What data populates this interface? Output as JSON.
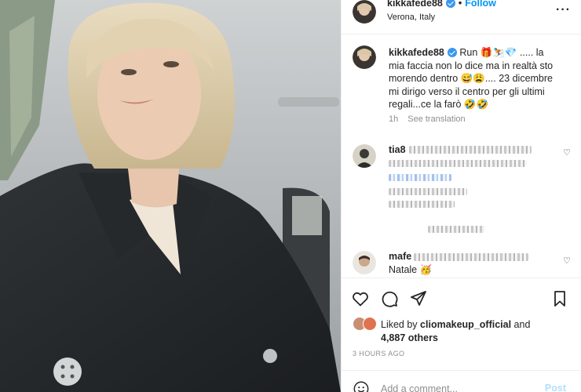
{
  "post": {
    "username": "kikkafede88",
    "separator": "•",
    "follow_label": "Follow",
    "location": "Verona, Italy",
    "more_icon": "more-horizontal-icon",
    "more_label": "···"
  },
  "caption": {
    "username": "kikkafede88",
    "text": "Run 🎁⛷️💎 ..... la mia faccia non lo dice ma in realtà sto morendo dentro 😅😩.... 23 dicembre mi dirigo verso il centro per gli ultimi regali...ce la farò 🤣🤣",
    "time": "1h",
    "translate_label": "See translation"
  },
  "comments": [
    {
      "username": "tia8",
      "heart_icon": "heart-outline-icon",
      "heart_label": "♡"
    },
    {
      "username": "mafe",
      "text": "Natale 🥳",
      "heart_icon": "heart-outline-icon",
      "heart_label": "♡"
    }
  ],
  "likes": {
    "prefix": "Liked by",
    "liker": "cliomakeup_official",
    "and_label": "and",
    "others": "4,887 others"
  },
  "time_ago": "3 HOURS AGO",
  "add_comment": {
    "placeholder": "Add a comment...",
    "post_label": "Post"
  },
  "colors": {
    "accent": "#0095f6",
    "verified": "#3897f0",
    "muted": "#8e8e8e"
  }
}
